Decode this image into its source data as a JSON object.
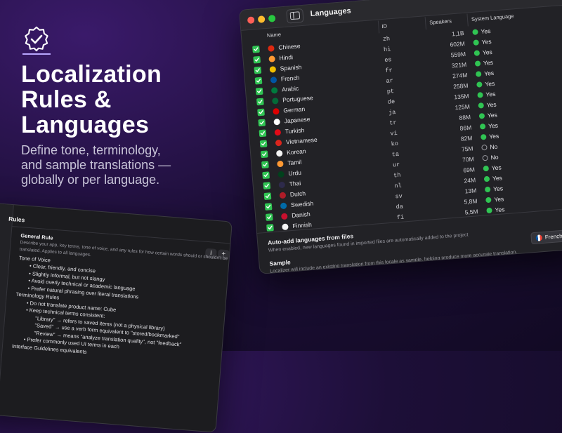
{
  "hero": {
    "headline": [
      "Localization",
      "Rules &",
      "Languages"
    ],
    "subhead": [
      "Define tone, terminology,",
      "and sample translations —",
      "globally or per language."
    ],
    "icon": "verified-badge-icon"
  },
  "languages_window": {
    "title": "Languages",
    "columns": {
      "name": "Name",
      "id": "ID",
      "speakers": "Speakers",
      "system": "System Language"
    },
    "rows": [
      {
        "name": "Chinese",
        "id": "zh",
        "speakers": "1,1B",
        "system": "Yes",
        "flag": "#de2910"
      },
      {
        "name": "Hindi",
        "id": "hi",
        "speakers": "602M",
        "system": "Yes",
        "flag": "#ff9933"
      },
      {
        "name": "Spanish",
        "id": "es",
        "speakers": "559M",
        "system": "Yes",
        "flag": "#f1bf00"
      },
      {
        "name": "French",
        "id": "fr",
        "speakers": "321M",
        "system": "Yes",
        "flag": "#0055a4"
      },
      {
        "name": "Arabic",
        "id": "ar",
        "speakers": "274M",
        "system": "Yes",
        "flag": "#007a3d"
      },
      {
        "name": "Portuguese",
        "id": "pt",
        "speakers": "258M",
        "system": "Yes",
        "flag": "#046a38"
      },
      {
        "name": "German",
        "id": "de",
        "speakers": "135M",
        "system": "Yes",
        "flag": "#dd0000"
      },
      {
        "name": "Japanese",
        "id": "ja",
        "speakers": "125M",
        "system": "Yes",
        "flag": "#ffffff"
      },
      {
        "name": "Turkish",
        "id": "tr",
        "speakers": "88M",
        "system": "Yes",
        "flag": "#e30a17"
      },
      {
        "name": "Vietnamese",
        "id": "vi",
        "speakers": "86M",
        "system": "Yes",
        "flag": "#da251d"
      },
      {
        "name": "Korean",
        "id": "ko",
        "speakers": "82M",
        "system": "Yes",
        "flag": "#f4f4f4"
      },
      {
        "name": "Tamil",
        "id": "ta",
        "speakers": "75M",
        "system": "No",
        "flag": "#ff9933"
      },
      {
        "name": "Urdu",
        "id": "ur",
        "speakers": "70M",
        "system": "No",
        "flag": "#01411c"
      },
      {
        "name": "Thai",
        "id": "th",
        "speakers": "69M",
        "system": "Yes",
        "flag": "#2d2a4a"
      },
      {
        "name": "Dutch",
        "id": "nl",
        "speakers": "24M",
        "system": "Yes",
        "flag": "#ae1c28"
      },
      {
        "name": "Swedish",
        "id": "sv",
        "speakers": "13M",
        "system": "Yes",
        "flag": "#006aa7"
      },
      {
        "name": "Danish",
        "id": "da",
        "speakers": "5,8M",
        "system": "Yes",
        "flag": "#c8102e"
      },
      {
        "name": "Finnish",
        "id": "fi",
        "speakers": "5,5M",
        "system": "Yes",
        "flag": "#f5f5f5"
      }
    ],
    "auto_add_title": "Auto-add languages from files",
    "auto_add_desc": "When enabled, new languages found in imported files are automatically added to the project",
    "sample_title": "Sample",
    "sample_desc": "Localizer will include an existing translation from this locale as sample, helping produce more accurate translation.",
    "sample_value": "French",
    "colors": {
      "accent_green": "#30c453"
    }
  },
  "rules_window": {
    "title": "Rules",
    "info_label": "i",
    "add_label": "+",
    "lines": [
      {
        "text": "General Rule",
        "style": "b",
        "indent": 0
      },
      {
        "text": "Describe your app, key terms, tone of voice, and any rules for how certain words should or shouldn't be",
        "style": "dim",
        "indent": 0
      },
      {
        "text": "translated. Applies to all languages.",
        "style": "dim",
        "indent": 0
      },
      {
        "text": "Tone of Voice",
        "style": "",
        "indent": 0
      },
      {
        "text": "•     Clear, friendly, and concise",
        "style": "",
        "indent": 16
      },
      {
        "text": "•     Slightly informal, but not slangy",
        "style": "",
        "indent": 16
      },
      {
        "text": "•     Avoid overly technical or academic language",
        "style": "",
        "indent": 16
      },
      {
        "text": "•     Prefer natural phrasing over literal translations",
        "style": "",
        "indent": 16
      },
      {
        "text": "Terminology Rules",
        "style": "",
        "indent": 0
      },
      {
        "text": "•     Do not translate product name: Cube",
        "style": "",
        "indent": 16
      },
      {
        "text": "•     Keep technical terms consistent:",
        "style": "",
        "indent": 16
      },
      {
        "text": "\"Library\" → refers to saved items (not a physical library)",
        "style": "",
        "indent": 30
      },
      {
        "text": "\"Saved\" → use a verb form equivalent to \"stored/bookmarked\"",
        "style": "",
        "indent": 30
      },
      {
        "text": "\"Review\" → means \"analyze translation quality\", not \"feedback\"",
        "style": "",
        "indent": 30
      },
      {
        "text": "•     Prefer commonly used UI terms in each",
        "style": "",
        "indent": 16
      },
      {
        "text": "Interface Guidelines equivalents",
        "style": "",
        "indent": 0
      }
    ]
  }
}
